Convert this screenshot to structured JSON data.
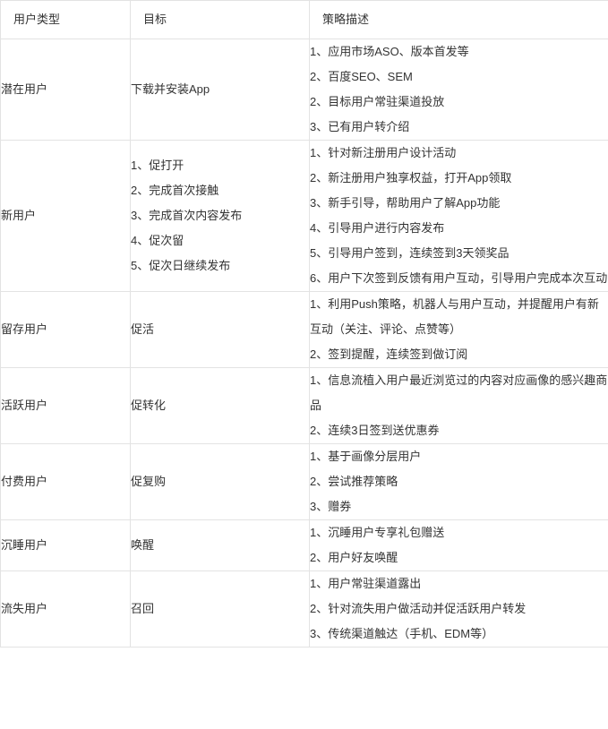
{
  "table": {
    "headers": [
      {
        "label": "用户类型"
      },
      {
        "label": "目标"
      },
      {
        "label": "策略描述"
      }
    ],
    "rows": [
      {
        "user_type": "潜在用户",
        "goal_single": "下载并安装App",
        "goals": [],
        "strategies": [
          "1、应用市场ASO、版本首发等",
          "2、百度SEO、SEM",
          "2、目标用户常驻渠道投放",
          "3、已有用户转介绍"
        ]
      },
      {
        "user_type": "新用户",
        "goal_single": "",
        "goals": [
          "1、促打开",
          "2、完成首次接触",
          "3、完成首次内容发布",
          "4、促次留",
          "5、促次日继续发布"
        ],
        "strategies": [
          "1、针对新注册用户设计活动",
          "2、新注册用户独享权益，打开App领取",
          "3、新手引导，帮助用户了解App功能",
          "4、引导用户进行内容发布",
          "5、引导用户签到，连续签到3天领奖品",
          "6、用户下次签到反馈有用户互动，引导用户完成本次互动"
        ]
      },
      {
        "user_type": "留存用户",
        "goal_single": "促活",
        "goals": [],
        "strategies": [
          "1、利用Push策略，机器人与用户互动，并提醒用户有新互动（关注、评论、点赞等）",
          "2、签到提醒，连续签到做订阅"
        ]
      },
      {
        "user_type": "活跃用户",
        "goal_single": "促转化",
        "goals": [],
        "strategies": [
          "1、信息流植入用户最近浏览过的内容对应画像的感兴趣商品",
          "2、连续3日签到送优惠券"
        ]
      },
      {
        "user_type": "付费用户",
        "goal_single": "促复购",
        "goals": [],
        "strategies": [
          "1、基于画像分层用户",
          "2、尝试推荐策略",
          "3、赠券"
        ]
      },
      {
        "user_type": "沉睡用户",
        "goal_single": "唤醒",
        "goals": [],
        "strategies": [
          "1、沉睡用户专享礼包赠送",
          "2、用户好友唤醒"
        ]
      },
      {
        "user_type": "流失用户",
        "goal_single": "召回",
        "goals": [],
        "strategies": [
          "1、用户常驻渠道露出",
          "2、针对流失用户做活动并促活跃用户转发",
          "3、传统渠道触达（手机、EDM等）"
        ]
      }
    ]
  },
  "colors": {
    "border": "#e3e3e3",
    "text": "#333333",
    "background": "#ffffff"
  }
}
